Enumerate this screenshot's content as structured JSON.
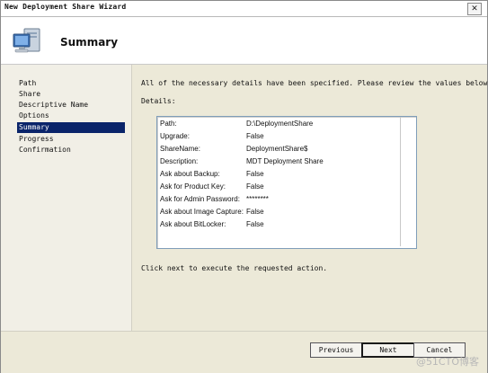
{
  "window": {
    "title": "New Deployment Share Wizard",
    "close_glyph": "✕"
  },
  "header": {
    "title": "Summary",
    "icon": "computer-icon"
  },
  "nav": {
    "items": [
      {
        "label": "Path"
      },
      {
        "label": "Share"
      },
      {
        "label": "Descriptive Name"
      },
      {
        "label": "Options"
      },
      {
        "label": "Summary"
      },
      {
        "label": "Progress"
      },
      {
        "label": "Confirmation"
      }
    ],
    "selected": "Summary",
    "selected_color": "#0a246a"
  },
  "content": {
    "intro": "All of the necessary details have been specified.  Please review the values below.",
    "details_label": "Details:",
    "details": [
      {
        "key": "Path:",
        "value": "D:\\DeploymentShare"
      },
      {
        "key": "Upgrade:",
        "value": "False"
      },
      {
        "key": "ShareName:",
        "value": "DeploymentShare$"
      },
      {
        "key": "Description:",
        "value": "MDT Deployment Share"
      },
      {
        "key": "Ask about Backup:",
        "value": "False"
      },
      {
        "key": "Ask for Product Key:",
        "value": "False"
      },
      {
        "key": "Ask for Admin Password:",
        "value": "********"
      },
      {
        "key": "Ask about Image Capture:",
        "value": "False"
      },
      {
        "key": "Ask about BitLocker:",
        "value": "False"
      }
    ],
    "footer": "Click next to execute the requested action."
  },
  "buttons": {
    "previous": "Previous",
    "next": "Next",
    "cancel": "Cancel"
  },
  "watermark": "@51CTO博客"
}
